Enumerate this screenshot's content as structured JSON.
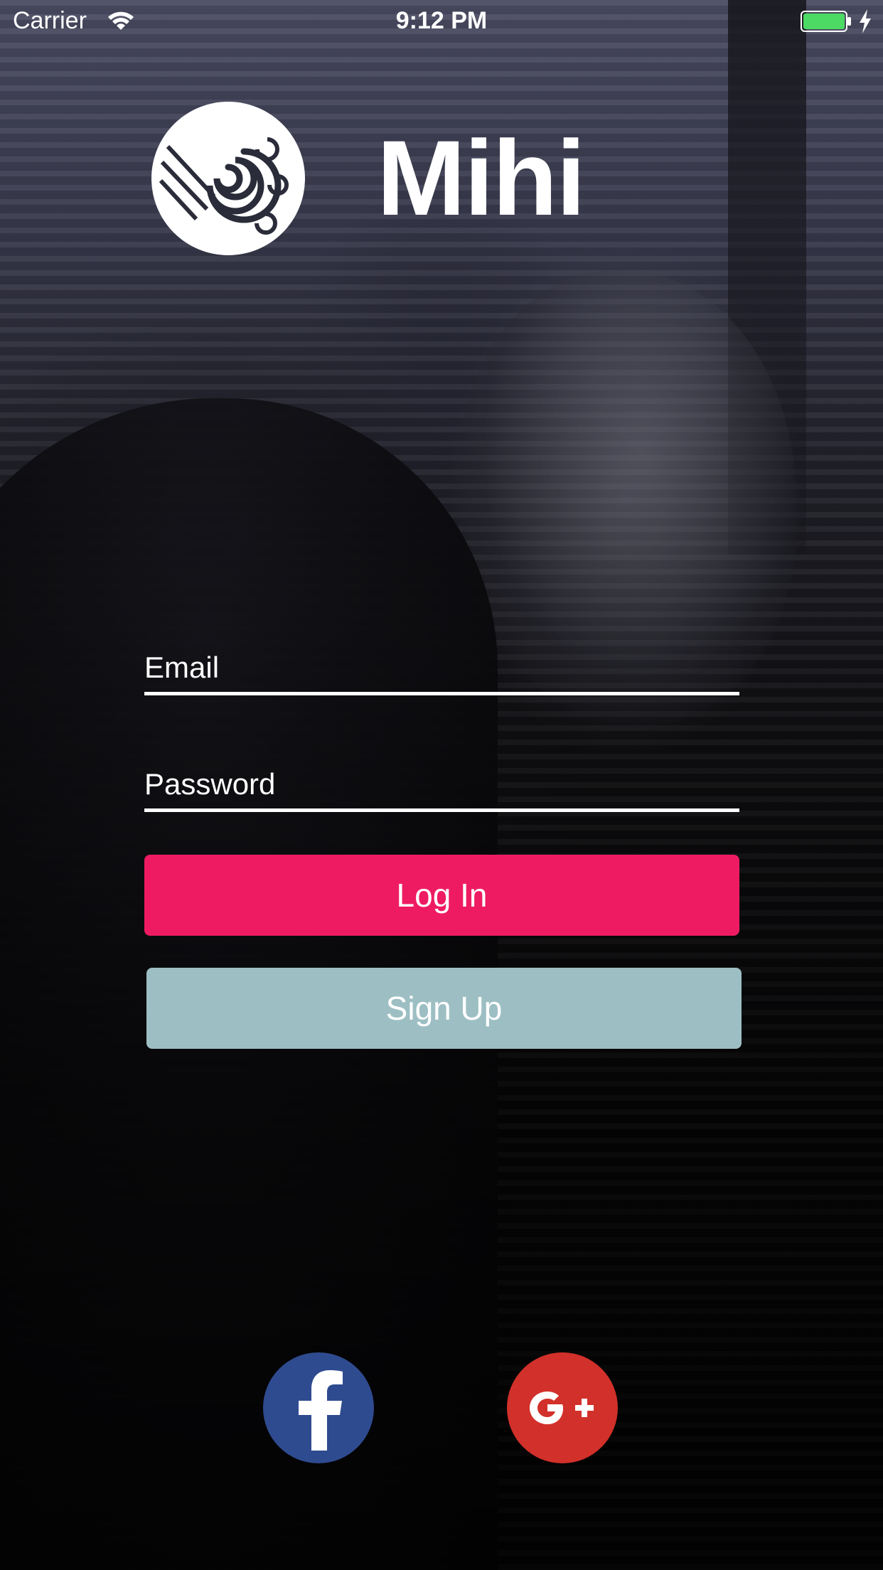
{
  "status_bar": {
    "carrier": "Carrier",
    "time": "9:12 PM"
  },
  "app": {
    "title": "Mihi"
  },
  "form": {
    "email_placeholder": "Email",
    "password_placeholder": "Password",
    "login_label": "Log In",
    "signup_label": "Sign Up"
  },
  "social": {
    "facebook_icon": "facebook-icon",
    "google_icon": "google-plus-icon"
  },
  "colors": {
    "login_button": "#ee1b63",
    "signup_button": "#9dbfc4",
    "facebook": "#2f4b8f",
    "google": "#d2302a",
    "battery": "#4cd964"
  }
}
